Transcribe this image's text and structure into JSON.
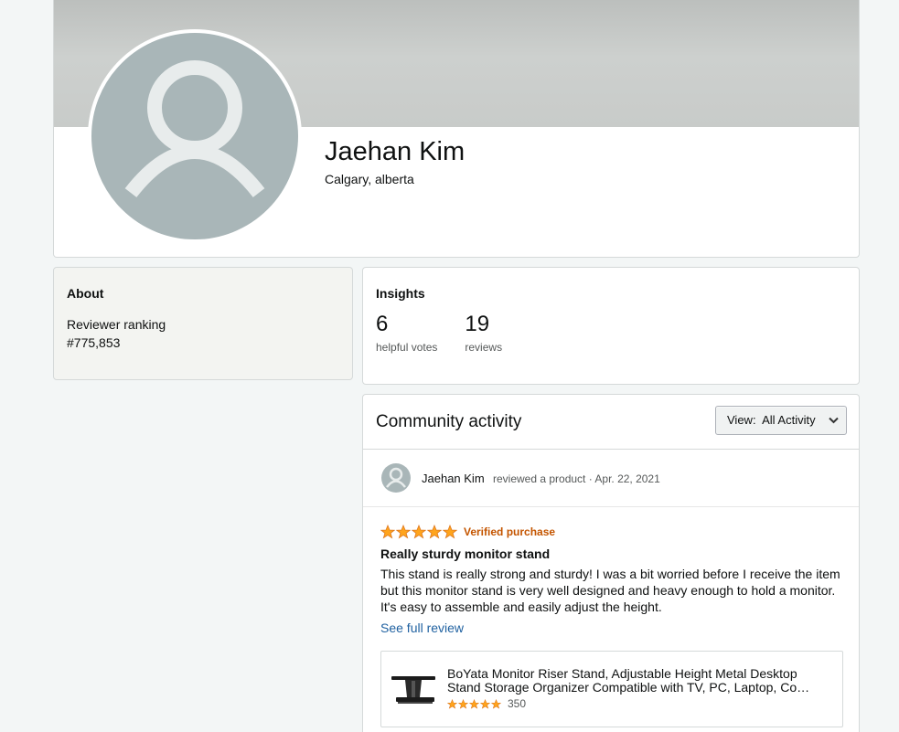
{
  "profile": {
    "name": "Jaehan Kim",
    "location": "Calgary, alberta",
    "avatar_icon": "person-silhouette-icon"
  },
  "about": {
    "heading": "About",
    "ranking_label": "Reviewer ranking",
    "ranking_value": "#775,853"
  },
  "insights": {
    "heading": "Insights",
    "stats": [
      {
        "value": "6",
        "label": "helpful votes"
      },
      {
        "value": "19",
        "label": "reviews"
      }
    ]
  },
  "activity": {
    "title": "Community activity",
    "view_label": "View:",
    "view_value": "All Activity",
    "review": {
      "author": "Jaehan Kim",
      "action": "reviewed a product · Apr. 22, 2021",
      "star_rating": 5,
      "verified": "Verified purchase",
      "title": "Really sturdy monitor stand",
      "text": "This stand is really strong and sturdy! I was a bit worried before I receive the item but this monitor stand is very well designed and heavy enough to hold a monitor. It's easy to assemble and easily adjust the height.",
      "see_full": "See full review",
      "product": {
        "title": "BoYata Monitor Riser Stand, Adjustable Height Metal Desktop Stand Storage Organizer Compatible with TV, PC, Laptop, Co…",
        "star_rating": 5,
        "rating_count": "350"
      }
    }
  },
  "colors": {
    "star": "#ffa41c",
    "verified": "#c45500",
    "link": "#2162a1",
    "avatar_bg": "#a9b6b8"
  }
}
